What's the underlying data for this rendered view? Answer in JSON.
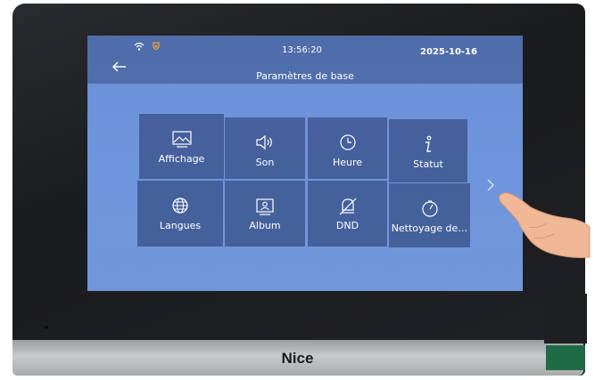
{
  "status": {
    "time": "13:56:20",
    "date": "2025-10-16"
  },
  "header": {
    "title": "Paramètres de base"
  },
  "tiles": [
    {
      "label": "Affichage",
      "icon": "image-icon"
    },
    {
      "label": "Son",
      "icon": "speaker-icon"
    },
    {
      "label": "Heure",
      "icon": "clock-icon"
    },
    {
      "label": "Statut",
      "icon": "info-icon"
    },
    {
      "label": "Langues",
      "icon": "globe-icon"
    },
    {
      "label": "Album",
      "icon": "album-icon"
    },
    {
      "label": "DND",
      "icon": "bell-off-icon"
    },
    {
      "label": "Nettoyage de…",
      "icon": "timer-icon"
    }
  ],
  "device": {
    "brand": "Nice"
  }
}
